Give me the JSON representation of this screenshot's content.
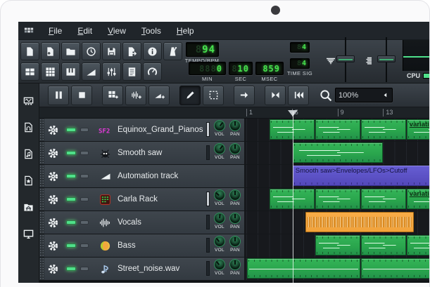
{
  "menu": {
    "items": [
      "File",
      "Edit",
      "View",
      "Tools",
      "Help"
    ]
  },
  "main_toolbar": {
    "row1": [
      {
        "name": "new-project",
        "icon": "file-new"
      },
      {
        "name": "new-from-template",
        "icon": "file-template"
      },
      {
        "name": "open-project",
        "icon": "folder-open"
      },
      {
        "name": "recently-opened-projects",
        "icon": "clock"
      },
      {
        "name": "save-project",
        "icon": "floppy"
      },
      {
        "name": "export-project",
        "icon": "file-export"
      },
      {
        "name": "project-properties",
        "icon": "info"
      },
      {
        "name": "metronome",
        "icon": "metronome"
      }
    ],
    "row2": [
      {
        "name": "song-editor",
        "icon": "grid-song"
      },
      {
        "name": "beat-bassline-editor",
        "icon": "grid-bb"
      },
      {
        "name": "piano-roll",
        "icon": "piano"
      },
      {
        "name": "automation-editor",
        "icon": "ramp"
      },
      {
        "name": "fx-mixer",
        "icon": "faders"
      },
      {
        "name": "project-notes",
        "icon": "notes"
      },
      {
        "name": "controller-rack",
        "icon": "controller"
      }
    ]
  },
  "lcds": {
    "tempo": {
      "pad": "8",
      "value": "94",
      "label": "TEMPO/BPM"
    },
    "minutes": {
      "pad": "888",
      "value": "0",
      "label": "MIN"
    },
    "seconds": {
      "pad": "8",
      "value": "10",
      "label": "SEC"
    },
    "milliseconds": {
      "pad": "",
      "value": "859",
      "label": "MSEC"
    },
    "timesig": {
      "numerator_pad": "8",
      "numerator": "4",
      "denominator_pad": "8",
      "denominator": "4",
      "label": "TIME SIG"
    }
  },
  "cpu": {
    "label": "CPU",
    "meter_fill_percent": 50
  },
  "song_toolbar": {
    "buttons": [
      {
        "name": "pause",
        "icon": "pause",
        "gap": false,
        "active": false
      },
      {
        "name": "stop",
        "icon": "stop",
        "gap": false,
        "active": false
      },
      {
        "name": "add-bb-track",
        "icon": "add-bb",
        "gap": true,
        "active": false
      },
      {
        "name": "add-sample-track",
        "icon": "add-sample",
        "gap": false,
        "active": false
      },
      {
        "name": "add-automation-track",
        "icon": "add-automation",
        "gap": false,
        "active": false
      },
      {
        "name": "draw-mode",
        "icon": "pencil",
        "gap": true,
        "active": true
      },
      {
        "name": "edit-mode",
        "icon": "select",
        "gap": false,
        "active": false
      },
      {
        "name": "follow-playhead",
        "icon": "arrow-right",
        "gap": true,
        "active": false
      },
      {
        "name": "stop-behaviour",
        "icon": "bounce",
        "gap": true,
        "active": false
      },
      {
        "name": "rewind-to-start",
        "icon": "rewind",
        "gap": false,
        "active": false
      }
    ],
    "zoom": {
      "value": "100%"
    }
  },
  "sidebar": {
    "items": [
      {
        "name": "instruments",
        "icon": "plugin"
      },
      {
        "name": "samples",
        "icon": "file-headphones"
      },
      {
        "name": "presets",
        "icon": "file-note"
      },
      {
        "name": "favorites",
        "icon": "file-star"
      },
      {
        "name": "home",
        "icon": "folder-home"
      },
      {
        "name": "computer",
        "icon": "monitor"
      }
    ]
  },
  "timeline": {
    "bar_labels": [
      1,
      5,
      9,
      13
    ],
    "playhead_bar": 5
  },
  "track_labels": {
    "vol": "VOL",
    "pan": "PAN"
  },
  "tracks": [
    {
      "name": "Equinox_Grand_Pianos",
      "icon": "sf2",
      "has_knobs": true,
      "meter_lit": true,
      "vol_angle": 40,
      "pan_angle": 0,
      "segments": [
        {
          "start": 3,
          "end": 7,
          "kind": "midi"
        },
        {
          "start": 7,
          "end": 11,
          "kind": "midi"
        },
        {
          "start": 11,
          "end": 15,
          "kind": "midi"
        },
        {
          "start": 15,
          "end": 19,
          "kind": "midi",
          "label": "variation"
        }
      ]
    },
    {
      "name": "Smooth saw",
      "icon": "bug",
      "has_knobs": true,
      "meter_lit": false,
      "vol_angle": 40,
      "pan_angle": 0,
      "segments": [
        {
          "start": 5,
          "end": 13,
          "kind": "midi"
        }
      ]
    },
    {
      "name": "Automation track",
      "icon": "ramp-white",
      "has_knobs": false,
      "meter_lit": false,
      "vol_angle": 0,
      "pan_angle": 0,
      "segments": [
        {
          "start": 5,
          "end": 19,
          "kind": "automation",
          "label": "Smooth saw>Envelopes/LFOs>Cutoff"
        }
      ]
    },
    {
      "name": "Carla Rack",
      "icon": "carla",
      "has_knobs": true,
      "meter_lit": true,
      "vol_angle": -50,
      "pan_angle": 0,
      "segments": [
        {
          "start": 3,
          "end": 7,
          "kind": "midi"
        },
        {
          "start": 7,
          "end": 11,
          "kind": "midi"
        },
        {
          "start": 11,
          "end": 15,
          "kind": "midi"
        },
        {
          "start": 15,
          "end": 19,
          "kind": "midi",
          "label": "variation"
        }
      ]
    },
    {
      "name": "Vocals",
      "icon": "waveform",
      "has_knobs": true,
      "meter_lit": false,
      "vol_angle": 5,
      "pan_angle": 0,
      "segments": [
        {
          "start": 6.1,
          "end": 15.7,
          "kind": "audio"
        }
      ]
    },
    {
      "name": "Bass",
      "icon": "fruit",
      "has_knobs": true,
      "meter_lit": false,
      "vol_angle": -40,
      "pan_angle": 0,
      "segments": [
        {
          "start": 7,
          "end": 11,
          "kind": "midi"
        },
        {
          "start": 11,
          "end": 15,
          "kind": "midi"
        },
        {
          "start": 15,
          "end": 19,
          "kind": "midi"
        }
      ]
    },
    {
      "name": "Street_noise.wav",
      "icon": "note",
      "has_knobs": true,
      "meter_lit": false,
      "vol_angle": -40,
      "pan_angle": 0,
      "segments": [
        {
          "start": 1,
          "end": 11,
          "kind": "sample"
        },
        {
          "start": 11,
          "end": 21,
          "kind": "sample"
        }
      ]
    }
  ],
  "colors": {
    "pattern_green": "#2aa64d",
    "automation_purple": "#5b51c8",
    "sample_orange": "#f2a33c",
    "lcd_green": "#47e14d",
    "led_green": "#4fe08a"
  }
}
